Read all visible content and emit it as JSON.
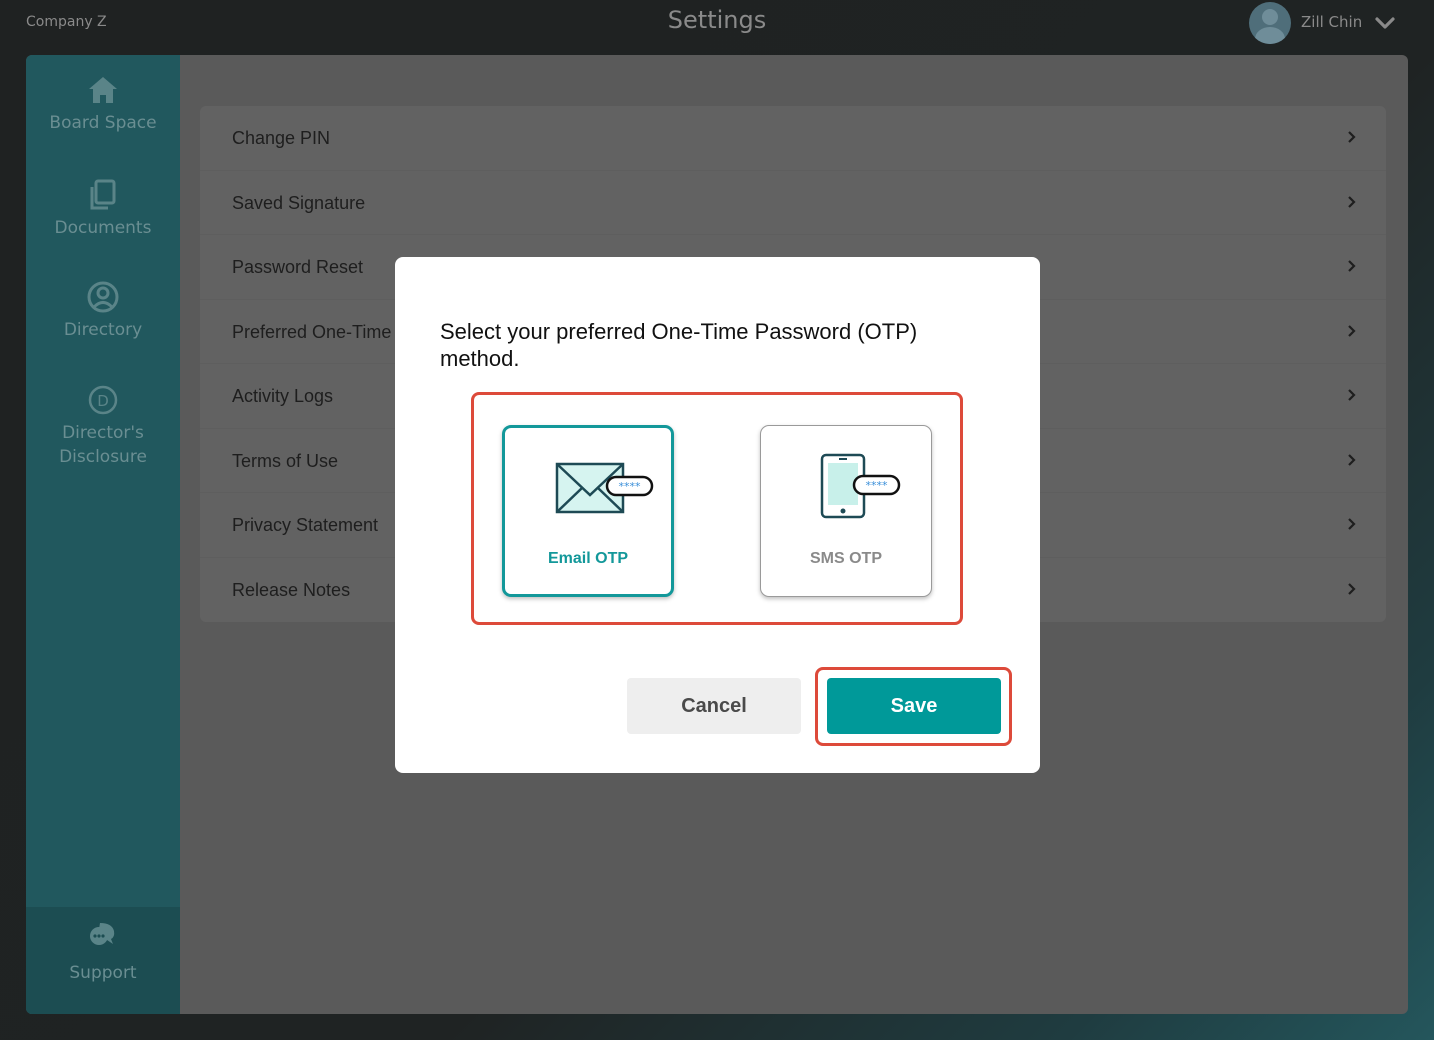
{
  "header": {
    "company": "Company Z",
    "title": "Settings",
    "user_name": "Zill Chin"
  },
  "sidebar": {
    "items": [
      {
        "label": "Board Space",
        "icon": "home-icon"
      },
      {
        "label": "Documents",
        "icon": "documents-icon"
      },
      {
        "label": "Directory",
        "icon": "user-circle-icon"
      },
      {
        "label": "Director's Disclosure",
        "icon": "d-circle-icon"
      }
    ],
    "support": {
      "label": "Support",
      "icon": "chat-bubbles-icon"
    }
  },
  "settings_list": [
    {
      "label": "Change PIN"
    },
    {
      "label": "Saved Signature"
    },
    {
      "label": "Password Reset"
    },
    {
      "label": "Preferred One-Time"
    },
    {
      "label": "Activity Logs"
    },
    {
      "label": "Terms of Use"
    },
    {
      "label": "Privacy Statement"
    },
    {
      "label": "Release Notes"
    }
  ],
  "modal": {
    "prompt": "Select your preferred One-Time Password (OTP) method.",
    "options": [
      {
        "label": "Email OTP",
        "icon": "envelope-password-icon",
        "selected": true
      },
      {
        "label": "SMS OTP",
        "icon": "phone-password-icon",
        "selected": false
      }
    ],
    "cancel_label": "Cancel",
    "save_label": "Save",
    "password_mask": "****"
  },
  "colors": {
    "accent": "#009999",
    "sidebar": "#21585e",
    "highlight": "#dd4a3a",
    "overlay": "#5a5a5a"
  }
}
